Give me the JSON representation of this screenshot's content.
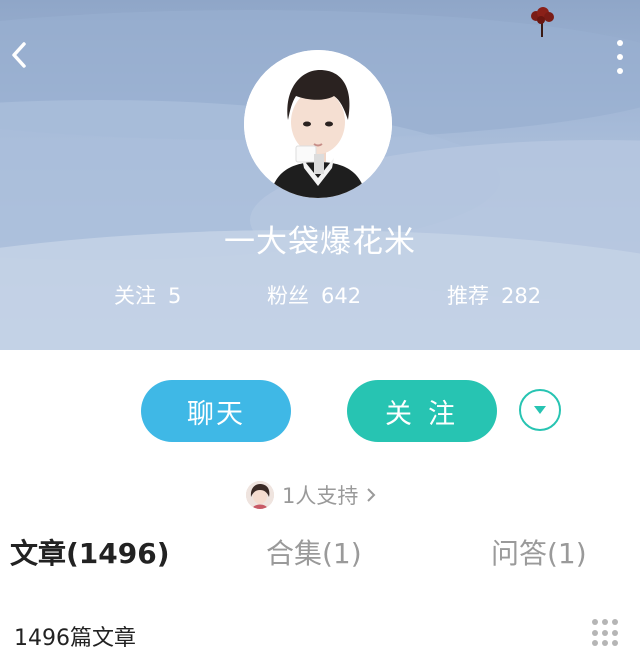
{
  "colors": {
    "chat_button": "#3fb8e6",
    "follow_button": "#27c4b2",
    "header_sky": "#a2b7d6",
    "muted_text": "#9a9a9a"
  },
  "header": {
    "back_icon": "chevron-left-icon",
    "more_icon": "vertical-dots-icon",
    "username": "一大袋爆花米"
  },
  "stats": {
    "following_label": "关注",
    "following_count": "5",
    "fans_label": "粉丝",
    "fans_count": "642",
    "recommend_label": "推荐",
    "recommend_count": "282"
  },
  "actions": {
    "chat_label": "聊天",
    "follow_label": "关注",
    "dropdown_icon": "chevron-down-circle-icon"
  },
  "support": {
    "text": "1人支持",
    "arrow_icon": "chevron-right-icon"
  },
  "tabs": [
    {
      "label": "文章(1496)",
      "active": true
    },
    {
      "label": "合集(1)",
      "active": false
    },
    {
      "label": "问答(1)",
      "active": false
    }
  ],
  "content": {
    "article_count_label": "1496篇文章",
    "layout_icon": "grid-dots-icon"
  }
}
